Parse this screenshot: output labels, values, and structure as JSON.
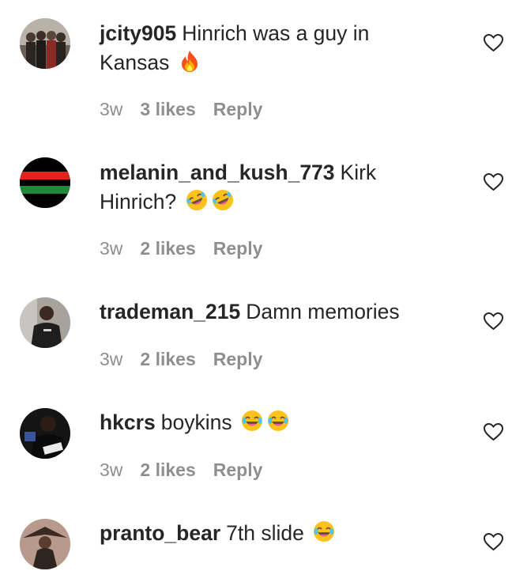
{
  "comments": [
    {
      "username": "jcity905",
      "text": "Hinrich was a guy in Kansas",
      "emoji": [
        "fire-emoji"
      ],
      "time": "3w",
      "likes": "3 likes",
      "reply": "Reply"
    },
    {
      "username": "melanin_and_kush_773",
      "text": "Kirk Hinrich?",
      "emoji": [
        "rofl-emoji",
        "rofl-emoji"
      ],
      "time": "3w",
      "likes": "2 likes",
      "reply": "Reply"
    },
    {
      "username": "trademan_215",
      "text": "Damn memories",
      "emoji": [],
      "time": "3w",
      "likes": "2 likes",
      "reply": "Reply"
    },
    {
      "username": "hkcrs",
      "text": "boykins",
      "emoji": [
        "joy-emoji",
        "joy-emoji"
      ],
      "time": "3w",
      "likes": "2 likes",
      "reply": "Reply"
    },
    {
      "username": "pranto_bear",
      "text": "7th slide",
      "emoji": [
        "joy-emoji"
      ],
      "time": "",
      "likes": "",
      "reply": ""
    }
  ],
  "colors": {
    "text": "#262626",
    "meta": "#8e8e8e",
    "emoji_yellow": "#fcc21b"
  }
}
